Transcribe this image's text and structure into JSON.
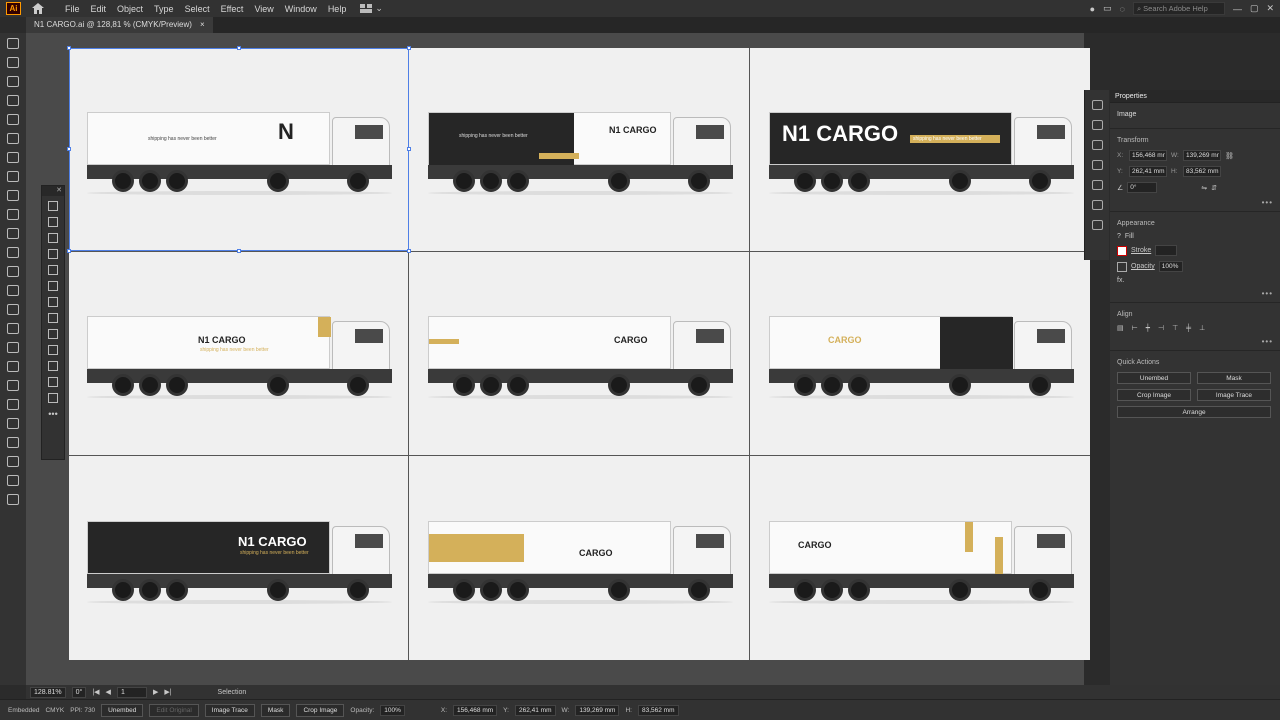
{
  "app": {
    "logo": "Ai",
    "menus": [
      "File",
      "Edit",
      "Object",
      "Type",
      "Select",
      "Effect",
      "View",
      "Window",
      "Help"
    ],
    "search_placeholder": "Search Adobe Help"
  },
  "document": {
    "tab_title": "N1 CARGO.ai @ 128,81 % (CMYK/Preview)",
    "tab_close": "×"
  },
  "canvas": {
    "trucks": [
      {
        "brand": "N",
        "tagline": "shipping has never been better",
        "style": "light"
      },
      {
        "brand": "N1 CARGO",
        "tagline": "shipping has never been better",
        "style": "dark-left"
      },
      {
        "brand": "N1 CARGO",
        "tagline": "shipping has never been better",
        "style": "dark"
      },
      {
        "brand": "N1 CARGO",
        "tagline": "shipping has never been better",
        "style": "light"
      },
      {
        "brand": "CARGO",
        "tagline": "",
        "style": "light"
      },
      {
        "brand": "CARGO",
        "tagline": "",
        "style": "light"
      },
      {
        "brand": "N1 CARGO",
        "tagline": "shipping has never been better",
        "style": "dark"
      },
      {
        "brand": "CARGO",
        "tagline": "",
        "style": "light"
      },
      {
        "brand": "CARGO",
        "tagline": "",
        "style": "light"
      }
    ]
  },
  "properties": {
    "title": "Properties",
    "object_type": "Image",
    "transform": {
      "title": "Transform",
      "x_label": "X:",
      "x": "156,468 mr",
      "w_label": "W:",
      "w": "139,269 mr",
      "y_label": "Y:",
      "y": "262,41 mm",
      "h_label": "H:",
      "h": "83,562 mm",
      "angle": "0°"
    },
    "appearance": {
      "title": "Appearance",
      "fill": "Fill",
      "stroke": "Stroke",
      "opacity_label": "Opacity",
      "opacity": "100%",
      "fx": "fx."
    },
    "align": {
      "title": "Align"
    },
    "quick_actions": {
      "title": "Quick Actions",
      "unembed": "Unembed",
      "mask": "Mask",
      "crop": "Crop Image",
      "trace": "Image Trace",
      "arrange": "Arrange"
    }
  },
  "status": {
    "zoom": "128.81%",
    "angle": "0°",
    "artboard": "1",
    "tool": "Selection"
  },
  "control": {
    "embedded": "Embedded",
    "mode": "CMYK",
    "ppi": "PPI: 730",
    "unembed": "Unembed",
    "edit_original": "Edit Original",
    "image_trace": "Image Trace",
    "mask": "Mask",
    "crop": "Crop Image",
    "opacity_label": "Opacity:",
    "opacity": "100%",
    "x_label": "X:",
    "x": "156,468 mm",
    "y_label": "Y:",
    "y": "262,41 mm",
    "w_label": "W:",
    "w": "139,269 mm",
    "h_label": "H:",
    "h": "83,562 mm"
  }
}
